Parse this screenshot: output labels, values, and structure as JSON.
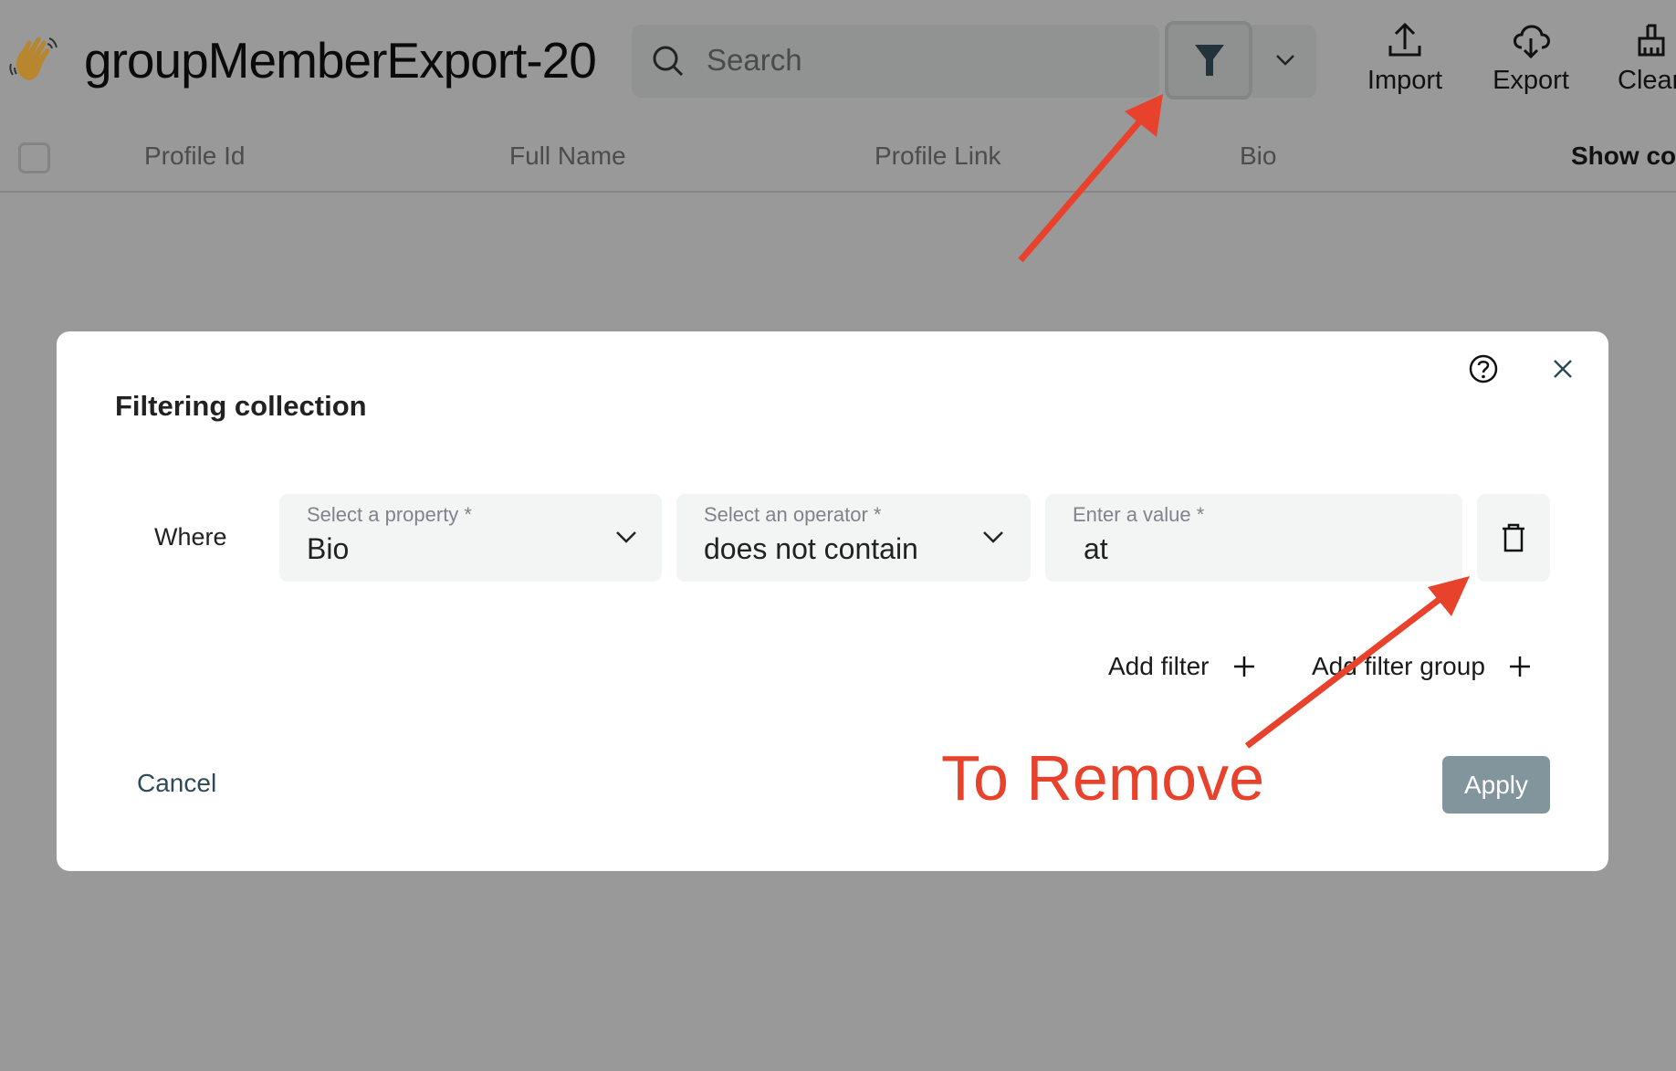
{
  "header": {
    "title": "groupMemberExport-20",
    "emoji_icon": "waving-hand-icon",
    "search_placeholder": "Search",
    "tools": [
      {
        "label": "Import",
        "icon": "upload-icon"
      },
      {
        "label": "Export",
        "icon": "cloud-download-icon"
      },
      {
        "label": "Clear",
        "icon": "broom-icon"
      }
    ]
  },
  "table": {
    "columns": [
      "Profile Id",
      "Full Name",
      "Profile Link",
      "Bio"
    ],
    "show_columns_label": "Show cou"
  },
  "modal": {
    "title": "Filtering collection",
    "where_label": "Where",
    "property": {
      "label": "Select a property *",
      "value": "Bio"
    },
    "operator": {
      "label": "Select an operator *",
      "value": "does not contain"
    },
    "value": {
      "label": "Enter a value *",
      "value": "at"
    },
    "add_filter": "Add filter",
    "add_filter_group": "Add filter group",
    "cancel": "Cancel",
    "apply": "Apply"
  },
  "annotation": {
    "text": "To Remove",
    "color": "#e8412c"
  },
  "colors": {
    "overlay": "#999999",
    "apply_button": "#82959c",
    "field_bg": "#f3f5f5"
  }
}
